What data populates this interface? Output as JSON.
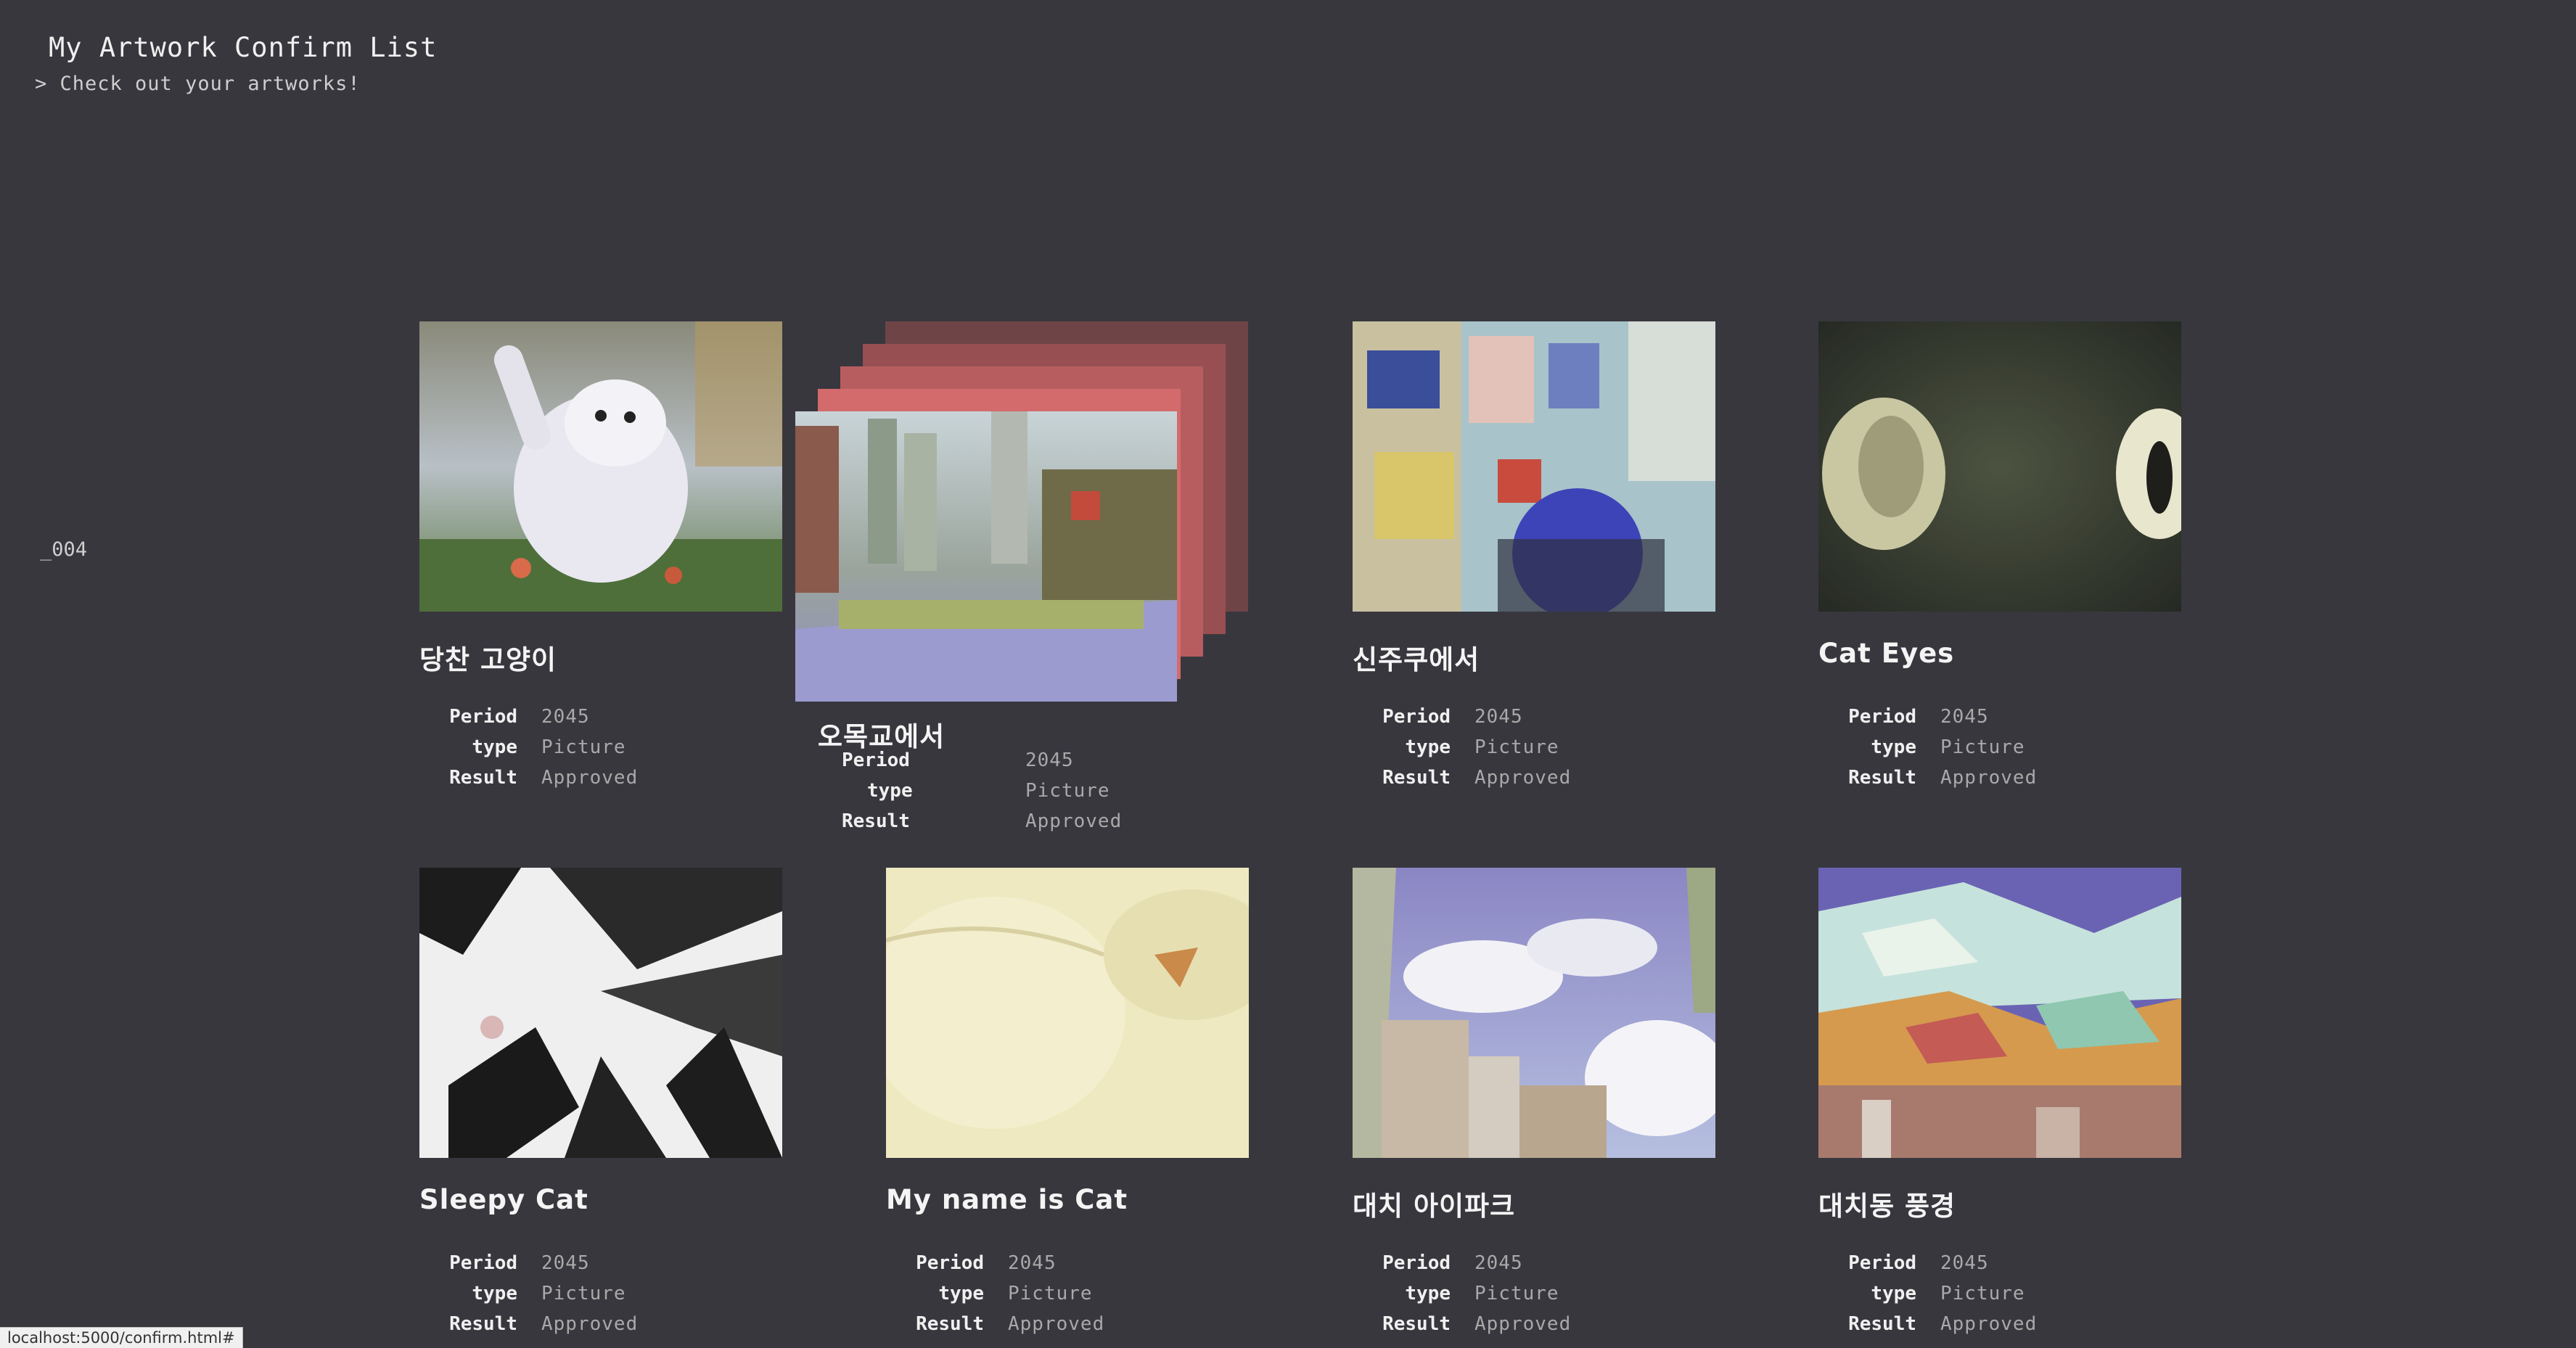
{
  "header": {
    "title": "My Artwork Confirm List",
    "subtitle": "> Check out your artworks!"
  },
  "side_index": "_004",
  "labels": {
    "period": "Period",
    "type": "type",
    "result": "Result"
  },
  "artworks": [
    {
      "title": "당찬 고양이",
      "period": "2045",
      "type": "Picture",
      "result": "Approved",
      "image": "white-cat-running-painting"
    },
    {
      "title": "오목교에서",
      "period": "2045",
      "type": "Picture",
      "result": "Approved",
      "image": "city-street-painting",
      "stacked": true
    },
    {
      "title": "신주쿠에서",
      "period": "2045",
      "type": "Picture",
      "result": "Approved",
      "image": "shinjuku-crowd-painting"
    },
    {
      "title": "Cat Eyes",
      "period": "2045",
      "type": "Picture",
      "result": "Approved",
      "image": "cat-eyes-painting"
    },
    {
      "title": "Sleepy Cat",
      "period": "2045",
      "type": "Picture",
      "result": "Approved",
      "image": "sleepy-cat-abstract-painting"
    },
    {
      "title": "My name is Cat",
      "period": "2045",
      "type": "Picture",
      "result": "Approved",
      "image": "cream-cat-closeup-painting"
    },
    {
      "title": "대치 아이파크",
      "period": "2045",
      "type": "Picture",
      "result": "Approved",
      "image": "apartment-sky-painting"
    },
    {
      "title": "대치동 풍경",
      "period": "2045",
      "type": "Picture",
      "result": "Approved",
      "image": "colorful-landscape-painting"
    }
  ],
  "status_bar": "localhost:5000/confirm.html#"
}
